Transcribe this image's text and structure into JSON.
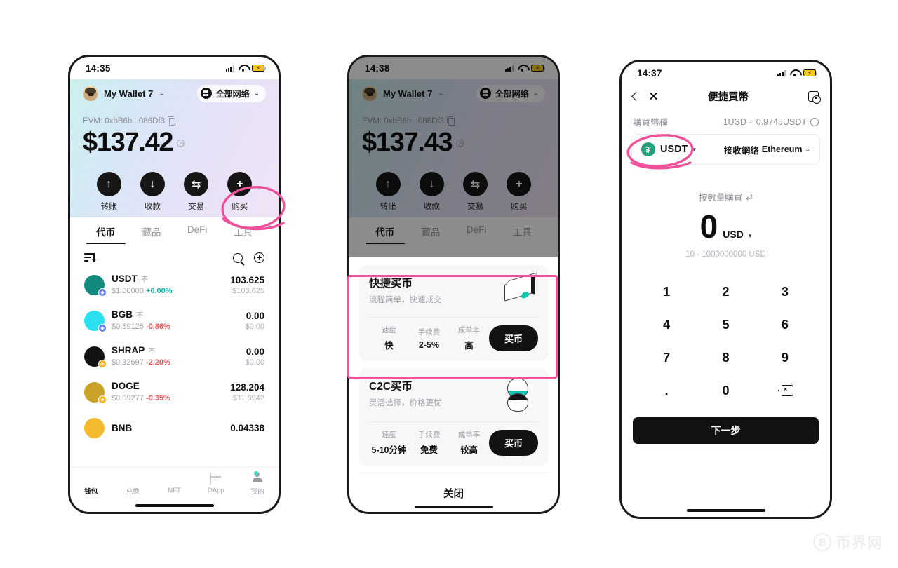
{
  "phone1": {
    "statusbar": {
      "time": "14:35"
    },
    "header": {
      "wallet_name": "My Wallet 7",
      "network_pill": "全部网络",
      "address": "EVM: 0xbB6b...086Df3",
      "balance": "$137.42"
    },
    "actions": [
      {
        "label": "转账",
        "icon": "arrow-up-icon",
        "glyph": "↑"
      },
      {
        "label": "收款",
        "icon": "arrow-down-icon",
        "glyph": "↓"
      },
      {
        "label": "交易",
        "icon": "swap-icon",
        "glyph": "⇆"
      },
      {
        "label": "购买",
        "icon": "plus-icon",
        "glyph": "+"
      }
    ],
    "tabs": [
      {
        "label": "代币",
        "active": true
      },
      {
        "label": "藏品",
        "active": false
      },
      {
        "label": "DeFi",
        "active": false
      },
      {
        "label": "工具",
        "active": false
      }
    ],
    "tokens": [
      {
        "symbol": "USDT",
        "chain_mark": "不",
        "price": "$1.00000",
        "change": "+0.00%",
        "dir": "up",
        "amount": "103.625",
        "value": "$103.625",
        "color": "#128a7d",
        "badge": "#6c7df0",
        "badge_text": "◆"
      },
      {
        "symbol": "BGB",
        "chain_mark": "不",
        "price": "$0.59125",
        "change": "-0.86%",
        "dir": "down",
        "amount": "0.00",
        "value": "$0.00",
        "color": "#2ae0ee",
        "badge": "#6c7df0",
        "badge_text": "◆"
      },
      {
        "symbol": "SHRAP",
        "chain_mark": "不",
        "price": "$0.32697",
        "change": "-2.20%",
        "dir": "down",
        "amount": "0.00",
        "value": "$0.00",
        "color": "#121212",
        "badge": "#f0b429",
        "badge_text": "◈"
      },
      {
        "symbol": "DOGE",
        "chain_mark": "",
        "price": "$0.09277",
        "change": "-0.35%",
        "dir": "down",
        "amount": "128.204",
        "value": "$11.8942",
        "color": "#c9a227",
        "badge": "#f0b429",
        "badge_text": "◈"
      },
      {
        "symbol": "BNB",
        "chain_mark": "",
        "price": "",
        "change": "",
        "dir": "up",
        "amount": "0.04338",
        "value": "",
        "color": "#f3ba2f",
        "badge": "",
        "badge_text": ""
      }
    ],
    "bottom_nav": [
      {
        "label": "钱包",
        "icon": "wallet-icon",
        "active": true,
        "badge": false
      },
      {
        "label": "兑换",
        "icon": "swap-icon",
        "active": false,
        "badge": false
      },
      {
        "label": "NFT",
        "icon": "nft-icon",
        "active": false,
        "badge": false
      },
      {
        "label": "DApp",
        "icon": "globe-icon",
        "active": false,
        "badge": false
      },
      {
        "label": "我的",
        "icon": "user-icon",
        "active": false,
        "badge": true
      }
    ]
  },
  "phone2": {
    "statusbar": {
      "time": "14:38"
    },
    "header": {
      "wallet_name": "My Wallet 7",
      "network_pill": "全部网络",
      "address": "EVM: 0xbB6b...086Df3",
      "balance": "$137.43"
    },
    "actions": [
      {
        "label": "转账",
        "glyph": "↑"
      },
      {
        "label": "收款",
        "glyph": "↓"
      },
      {
        "label": "交易",
        "glyph": "⇆"
      },
      {
        "label": "购买",
        "glyph": "+"
      }
    ],
    "tabs": [
      {
        "label": "代币",
        "active": true
      },
      {
        "label": "藏品",
        "active": false
      },
      {
        "label": "DeFi",
        "active": false
      },
      {
        "label": "工具",
        "active": false
      }
    ],
    "sheet": {
      "cards": [
        {
          "title": "快捷买币",
          "subtitle": "流程简单，快速成交",
          "art": "bank-card-icon",
          "stats": [
            {
              "key": "速度",
              "value": "快"
            },
            {
              "key": "手续费",
              "value": "2-5%"
            },
            {
              "key": "成单率",
              "value": "高"
            }
          ],
          "button": "买币"
        },
        {
          "title": "C2C买币",
          "subtitle": "灵活选择，价格更优",
          "art": "people-icon",
          "stats": [
            {
              "key": "速度",
              "value": "5-10分钟"
            },
            {
              "key": "手续费",
              "value": "免费"
            },
            {
              "key": "成单率",
              "value": "较高"
            }
          ],
          "button": "买币"
        }
      ],
      "close_label": "关闭"
    }
  },
  "phone3": {
    "statusbar": {
      "time": "14:37"
    },
    "header": {
      "title": "便捷買幣",
      "back_icon": "chevron-left-icon",
      "close_icon": "close-icon",
      "history_icon": "history-icon"
    },
    "rate": {
      "label": "購買幣種",
      "value": "1USD ≈ 0.9745USDT",
      "refresh_icon": "refresh-icon"
    },
    "coin_selector": {
      "coin": "USDT",
      "coin_icon": "usdt-icon",
      "coin_glyph": "₮",
      "network_label": "接收網絡",
      "network": "Ethereum"
    },
    "amount": {
      "mode_label": "按數量購買",
      "mode_icon": "swap-vertical-icon",
      "value": "0",
      "currency": "USD",
      "range": "10 - 1000000000 USD"
    },
    "keypad": [
      "1",
      "2",
      "3",
      "4",
      "5",
      "6",
      "7",
      "8",
      "9",
      ".",
      "0",
      "⌫"
    ],
    "next_button": "下一步"
  },
  "annotations": {
    "circle_color": "#f0509a",
    "rect_color": "#f0509a"
  },
  "watermark": {
    "text": "币界网",
    "coin_glyph": "₿"
  }
}
